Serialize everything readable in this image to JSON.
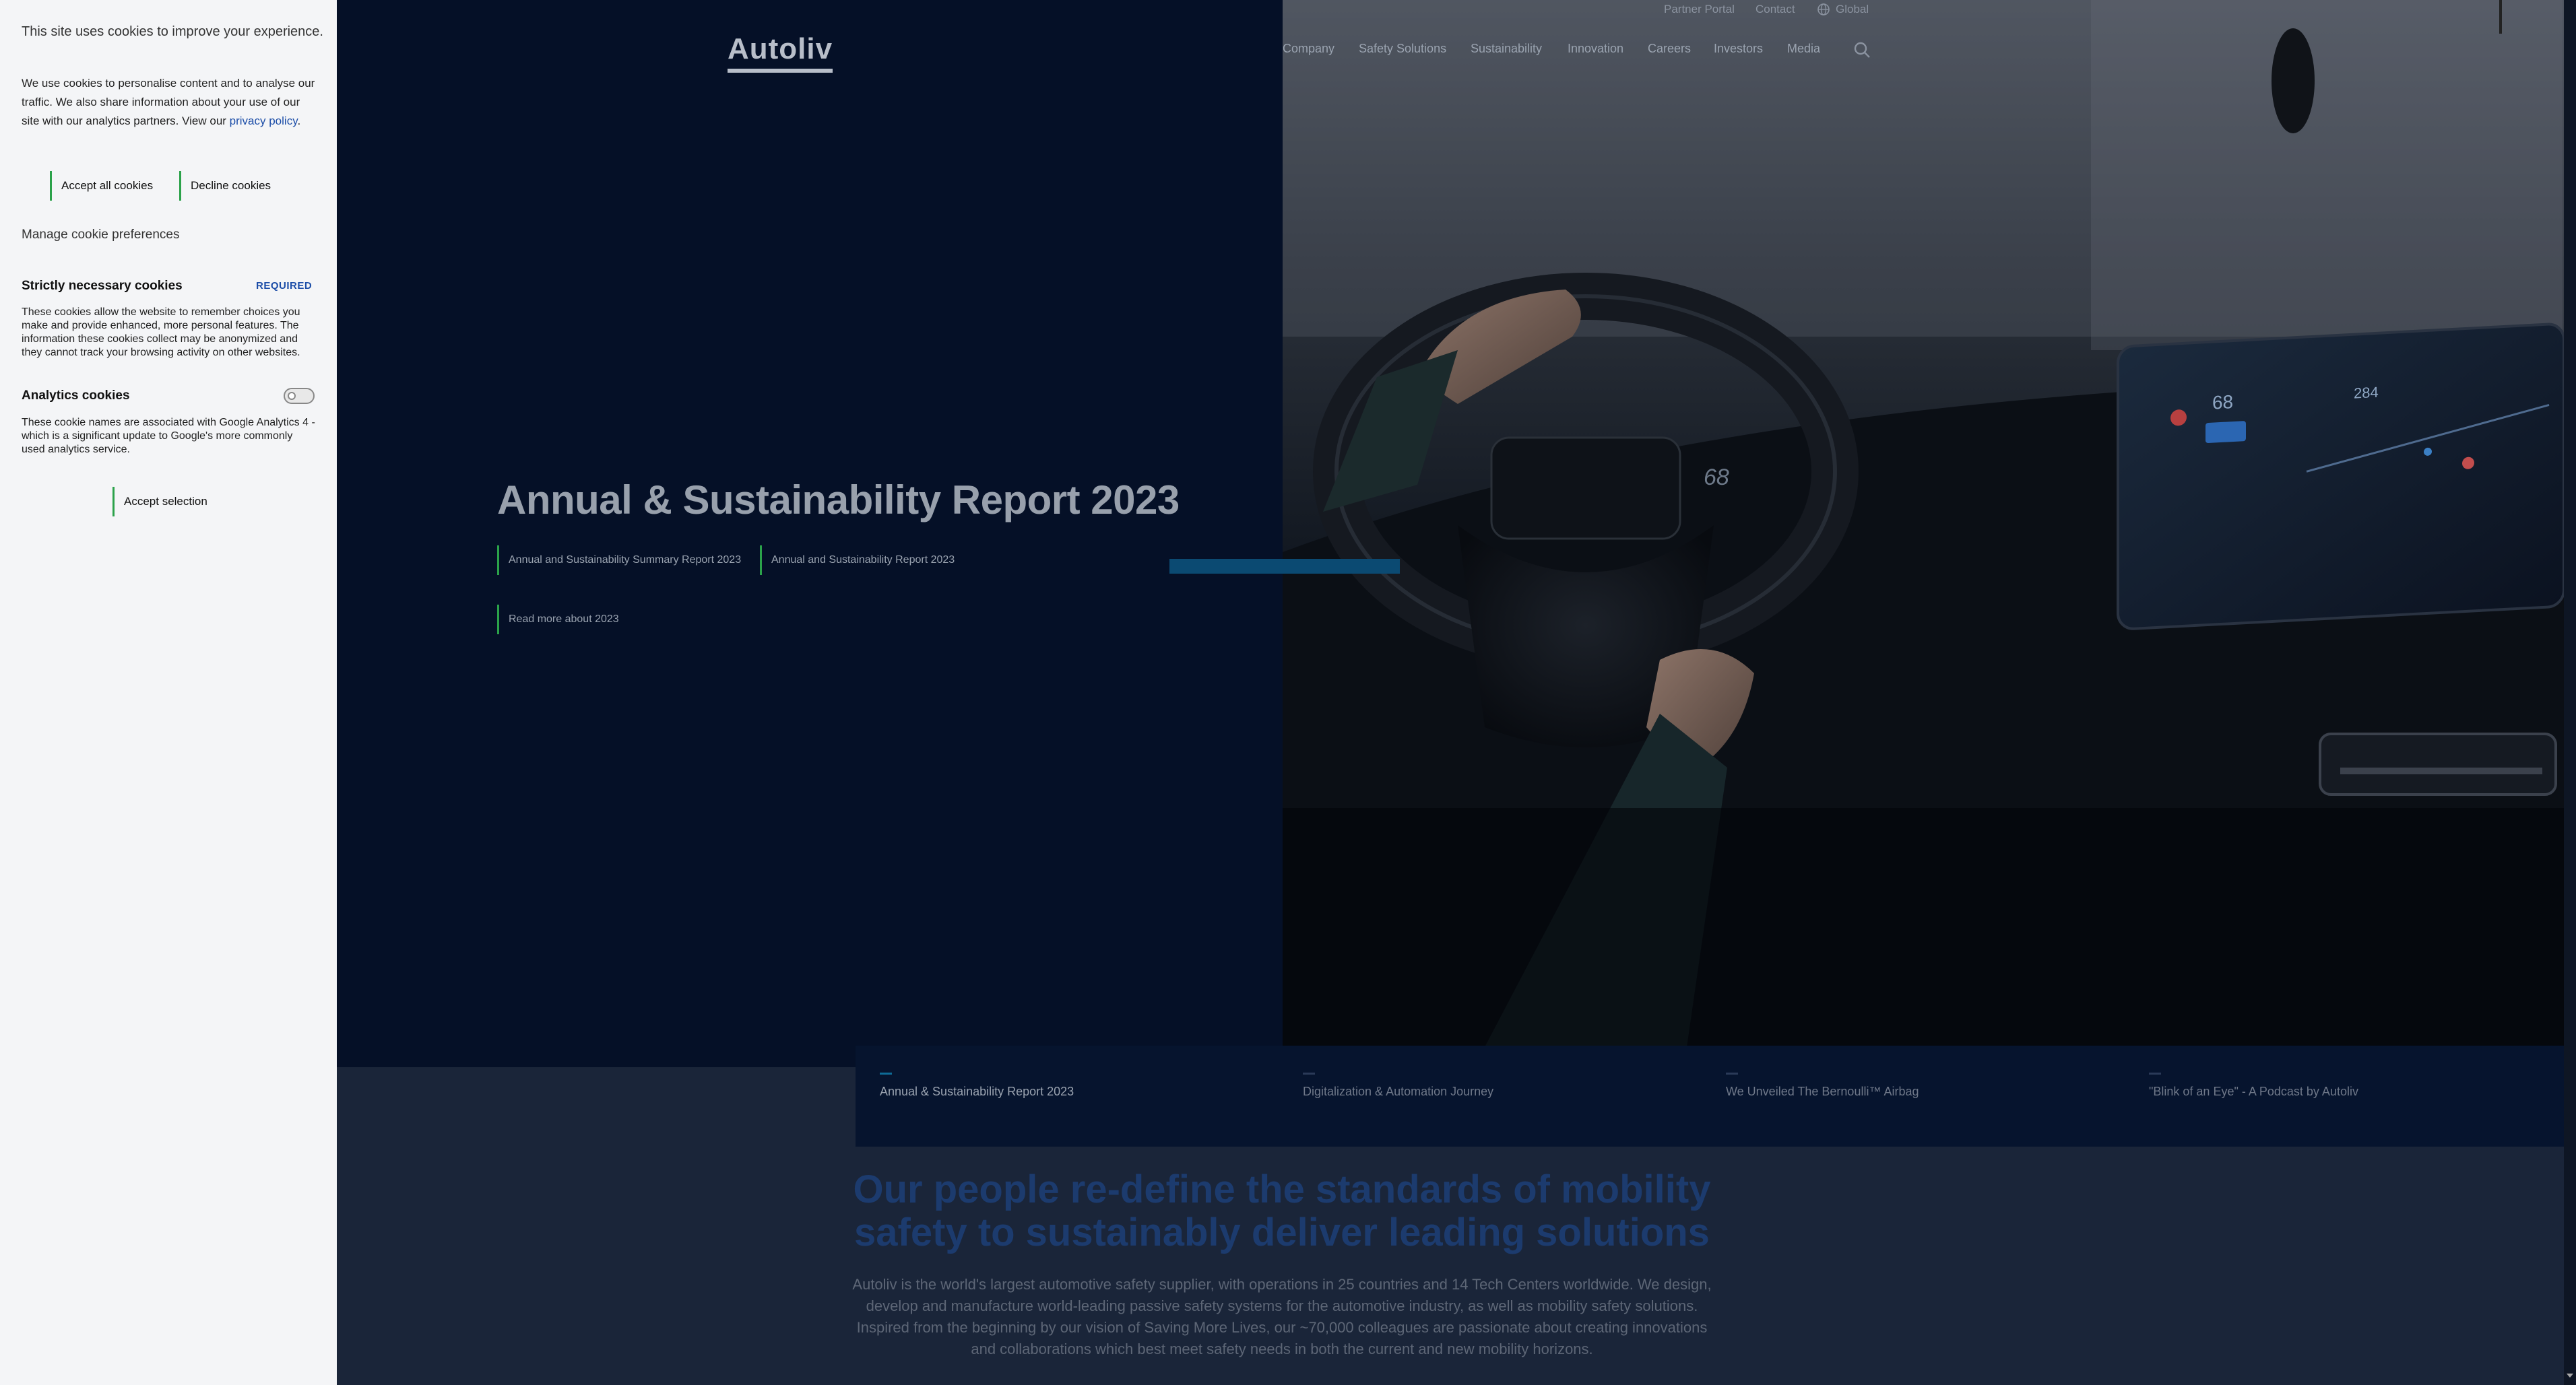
{
  "cookie_banner": {
    "title": "This site uses cookies to improve your experience.",
    "intro_text": "We use cookies to personalise content and to analyse our traffic. We also share information about your use of our site with our analytics partners. View our ",
    "privacy_link": "privacy policy",
    "intro_end": ".",
    "accept_all": "Accept all cookies",
    "decline": "Decline cookies",
    "manage": "Manage cookie preferences",
    "necessary_title": "Strictly necessary cookies",
    "necessary_badge": "REQUIRED",
    "necessary_text": "These cookies allow the website to remember choices you make and provide enhanced, more personal features. The information these cookies collect may be anonymized and they cannot track your browsing activity on other websites.",
    "analytics_title": "Analytics cookies",
    "analytics_enabled": false,
    "analytics_text": "These cookie names are associated with Google Analytics 4 - which is a significant update to Google's more commonly used analytics service.",
    "accept_selection": "Accept selection"
  },
  "header": {
    "logo": "Autoliv",
    "utility_nav": [
      "Partner Portal",
      "Contact",
      "Global"
    ],
    "main_nav": [
      "Company",
      "Safety Solutions",
      "Sustainability",
      "Innovation",
      "Careers",
      "Investors",
      "Media"
    ]
  },
  "hero": {
    "title": "Annual & Sustainability Report 2023",
    "link_summary": "Annual and Sustainability Summary Report 2023",
    "link_report": "Annual and Sustainability Report 2023",
    "link_read_more": "Read more about 2023",
    "dashboard": {
      "speed_left": "68",
      "speed_right": "68",
      "distance": "284"
    }
  },
  "tabs": [
    {
      "label": "Annual & Sustainability Report 2023",
      "active": true
    },
    {
      "label": "Digitalization & Automation Journey",
      "active": false
    },
    {
      "label": "We Unveiled The Bernoulli™ Airbag",
      "active": false
    },
    {
      "label": "\"Blink of an Eye\" - A Podcast by Autoliv",
      "active": false
    }
  ],
  "mission": {
    "heading": "Our people re-define the standards of mobility safety to sustainably deliver leading solutions",
    "body": "Autoliv is the world's largest automotive safety supplier, with operations in 25 countries and 14 Tech Centers worldwide. We design, develop and manufacture world-leading passive safety systems for the automotive industry, as well as mobility safety solutions. Inspired from the beginning by our vision of Saving More Lives, our ~70,000 colleagues are passionate about creating innovations and collaborations which best meet safety needs in both the current and new mobility horizons."
  },
  "colors": {
    "hero_bg": "#051027",
    "accent_green": "#2ba24a",
    "link_blue": "#1d4ea8",
    "heading_blue": "#1c3b6e"
  }
}
